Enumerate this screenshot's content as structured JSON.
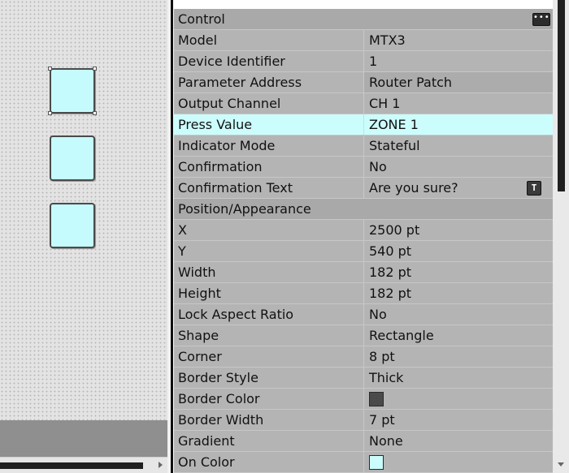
{
  "canvas": {
    "buttons": [
      {
        "name": "canvas-button-1",
        "selected": true
      },
      {
        "name": "canvas-button-2",
        "selected": false
      },
      {
        "name": "canvas-button-3",
        "selected": false
      }
    ],
    "button_fill": "#c5fbfc"
  },
  "properties": {
    "control_section": "Control",
    "model": {
      "label": "Model",
      "value": "MTX3"
    },
    "device_identifier": {
      "label": "Device Identifier",
      "value": "1"
    },
    "parameter_address": {
      "label": "Parameter Address",
      "value": "Router Patch"
    },
    "output_channel": {
      "label": "Output Channel",
      "value": "CH 1"
    },
    "press_value": {
      "label": "Press Value",
      "value": "ZONE 1"
    },
    "indicator_mode": {
      "label": "Indicator Mode",
      "value": "Stateful"
    },
    "confirmation": {
      "label": "Confirmation",
      "value": "No"
    },
    "confirmation_text": {
      "label": "Confirmation Text",
      "value": "Are you sure?"
    },
    "position_section": "Position/Appearance",
    "x": {
      "label": "X",
      "value": "2500 pt"
    },
    "y": {
      "label": "Y",
      "value": "540 pt"
    },
    "width": {
      "label": "Width",
      "value": "182 pt"
    },
    "height": {
      "label": "Height",
      "value": "182 pt"
    },
    "lock_aspect_ratio": {
      "label": "Lock Aspect Ratio",
      "value": "No"
    },
    "shape": {
      "label": "Shape",
      "value": "Rectangle"
    },
    "corner": {
      "label": "Corner",
      "value": "8 pt"
    },
    "border_style": {
      "label": "Border Style",
      "value": "Thick"
    },
    "border_color": {
      "label": "Border Color",
      "color": "#4a4a4a"
    },
    "border_width": {
      "label": "Border Width",
      "value": "7 pt"
    },
    "gradient": {
      "label": "Gradient",
      "value": "None"
    },
    "on_color": {
      "label": "On Color",
      "color": "#ccfdfd"
    }
  },
  "icons": {
    "section_menu": "ellipsis-icon",
    "text_edit": "text-edit-icon"
  }
}
